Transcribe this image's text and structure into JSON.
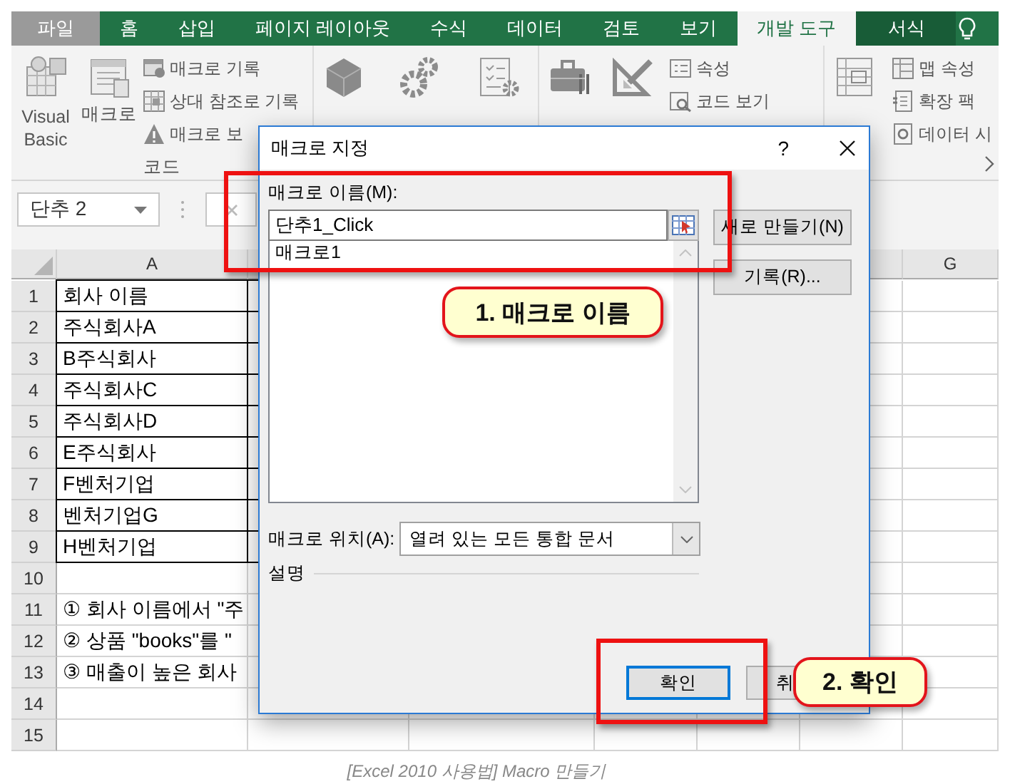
{
  "ribbon_tabs": [
    {
      "label": "파일",
      "kind": "file",
      "selected": false
    },
    {
      "label": "홈",
      "kind": "tab",
      "selected": false
    },
    {
      "label": "삽입",
      "kind": "tab",
      "selected": false
    },
    {
      "label": "페이지 레이아웃",
      "kind": "tab",
      "selected": false
    },
    {
      "label": "수식",
      "kind": "tab",
      "selected": false
    },
    {
      "label": "데이터",
      "kind": "tab",
      "selected": false
    },
    {
      "label": "검토",
      "kind": "tab",
      "selected": false
    },
    {
      "label": "보기",
      "kind": "tab",
      "selected": false
    },
    {
      "label": "개발 도구",
      "kind": "tab",
      "selected": true
    },
    {
      "label": "서식",
      "kind": "context",
      "selected": false
    }
  ],
  "ribbon": {
    "code_group": {
      "label": "코드",
      "large_buttons": [
        "Visual Basic",
        "매크로"
      ],
      "small_buttons": [
        "매크로 기록",
        "상대 참조로 기록",
        "매크로 보"
      ]
    },
    "controls_group": {
      "small_buttons": [
        "속성",
        "코드 보기"
      ]
    },
    "xml_group": {
      "small_buttons": [
        "맵 속성",
        "확장 팩",
        "데이터 시"
      ]
    }
  },
  "name_box": {
    "value": "단추 2"
  },
  "sheet": {
    "columns": [
      "A",
      "G"
    ],
    "rows": [
      {
        "number": "1",
        "cell": "회사 이름",
        "bordered": true
      },
      {
        "number": "2",
        "cell": "주식회사A",
        "bordered": true
      },
      {
        "number": "3",
        "cell": "B주식회사",
        "bordered": true
      },
      {
        "number": "4",
        "cell": "주식회사C",
        "bordered": true
      },
      {
        "number": "5",
        "cell": "주식회사D",
        "bordered": true
      },
      {
        "number": "6",
        "cell": "E주식회사",
        "bordered": true
      },
      {
        "number": "7",
        "cell": "F벤처기업",
        "bordered": true
      },
      {
        "number": "8",
        "cell": "벤처기업G",
        "bordered": true
      },
      {
        "number": "9",
        "cell": "H벤처기업",
        "bordered": true
      },
      {
        "number": "10",
        "bordered": false
      },
      {
        "number": "11",
        "cell": "① 회사 이름에서 \"주",
        "bordered": false
      },
      {
        "number": "12",
        "cell": "② 상품 \"books\"를 \"",
        "bordered": false
      },
      {
        "number": "13",
        "cell": "③ 매출이 높은 회사",
        "bordered": false
      },
      {
        "number": "14",
        "bordered": false
      },
      {
        "number": "15",
        "bordered": false
      }
    ]
  },
  "dialog": {
    "title": "매크로 지정",
    "help": "?",
    "name_label": "매크로 이름(M):",
    "name_value": "단추1_Click",
    "macro_list": [
      {
        "label": "매크로1",
        "selected": false
      }
    ],
    "side_buttons": [
      "새로 만들기(N)",
      "기록(R)..."
    ],
    "location_label": "매크로 위치(A):",
    "location_value": "열려 있는 모든 통합 문서",
    "description_label": "설명",
    "footer_buttons": [
      {
        "label": "확인",
        "default": true
      },
      {
        "label": "취",
        "default": false
      }
    ]
  },
  "callouts": [
    {
      "text": "1. 매크로 이름"
    },
    {
      "text": "2. 확인"
    }
  ],
  "caption": "[Excel 2010 사용법] Macro 만들기"
}
